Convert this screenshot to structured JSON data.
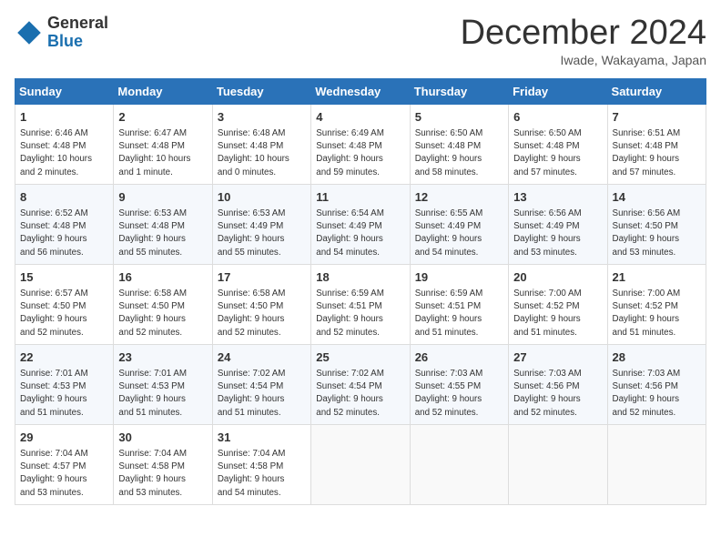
{
  "logo": {
    "general": "General",
    "blue": "Blue"
  },
  "header": {
    "month": "December 2024",
    "location": "Iwade, Wakayama, Japan"
  },
  "days_of_week": [
    "Sunday",
    "Monday",
    "Tuesday",
    "Wednesday",
    "Thursday",
    "Friday",
    "Saturday"
  ],
  "weeks": [
    [
      {
        "day": 1,
        "info": "Sunrise: 6:46 AM\nSunset: 4:48 PM\nDaylight: 10 hours\nand 2 minutes."
      },
      {
        "day": 2,
        "info": "Sunrise: 6:47 AM\nSunset: 4:48 PM\nDaylight: 10 hours\nand 1 minute."
      },
      {
        "day": 3,
        "info": "Sunrise: 6:48 AM\nSunset: 4:48 PM\nDaylight: 10 hours\nand 0 minutes."
      },
      {
        "day": 4,
        "info": "Sunrise: 6:49 AM\nSunset: 4:48 PM\nDaylight: 9 hours\nand 59 minutes."
      },
      {
        "day": 5,
        "info": "Sunrise: 6:50 AM\nSunset: 4:48 PM\nDaylight: 9 hours\nand 58 minutes."
      },
      {
        "day": 6,
        "info": "Sunrise: 6:50 AM\nSunset: 4:48 PM\nDaylight: 9 hours\nand 57 minutes."
      },
      {
        "day": 7,
        "info": "Sunrise: 6:51 AM\nSunset: 4:48 PM\nDaylight: 9 hours\nand 57 minutes."
      }
    ],
    [
      {
        "day": 8,
        "info": "Sunrise: 6:52 AM\nSunset: 4:48 PM\nDaylight: 9 hours\nand 56 minutes."
      },
      {
        "day": 9,
        "info": "Sunrise: 6:53 AM\nSunset: 4:48 PM\nDaylight: 9 hours\nand 55 minutes."
      },
      {
        "day": 10,
        "info": "Sunrise: 6:53 AM\nSunset: 4:49 PM\nDaylight: 9 hours\nand 55 minutes."
      },
      {
        "day": 11,
        "info": "Sunrise: 6:54 AM\nSunset: 4:49 PM\nDaylight: 9 hours\nand 54 minutes."
      },
      {
        "day": 12,
        "info": "Sunrise: 6:55 AM\nSunset: 4:49 PM\nDaylight: 9 hours\nand 54 minutes."
      },
      {
        "day": 13,
        "info": "Sunrise: 6:56 AM\nSunset: 4:49 PM\nDaylight: 9 hours\nand 53 minutes."
      },
      {
        "day": 14,
        "info": "Sunrise: 6:56 AM\nSunset: 4:50 PM\nDaylight: 9 hours\nand 53 minutes."
      }
    ],
    [
      {
        "day": 15,
        "info": "Sunrise: 6:57 AM\nSunset: 4:50 PM\nDaylight: 9 hours\nand 52 minutes."
      },
      {
        "day": 16,
        "info": "Sunrise: 6:58 AM\nSunset: 4:50 PM\nDaylight: 9 hours\nand 52 minutes."
      },
      {
        "day": 17,
        "info": "Sunrise: 6:58 AM\nSunset: 4:50 PM\nDaylight: 9 hours\nand 52 minutes."
      },
      {
        "day": 18,
        "info": "Sunrise: 6:59 AM\nSunset: 4:51 PM\nDaylight: 9 hours\nand 52 minutes."
      },
      {
        "day": 19,
        "info": "Sunrise: 6:59 AM\nSunset: 4:51 PM\nDaylight: 9 hours\nand 51 minutes."
      },
      {
        "day": 20,
        "info": "Sunrise: 7:00 AM\nSunset: 4:52 PM\nDaylight: 9 hours\nand 51 minutes."
      },
      {
        "day": 21,
        "info": "Sunrise: 7:00 AM\nSunset: 4:52 PM\nDaylight: 9 hours\nand 51 minutes."
      }
    ],
    [
      {
        "day": 22,
        "info": "Sunrise: 7:01 AM\nSunset: 4:53 PM\nDaylight: 9 hours\nand 51 minutes."
      },
      {
        "day": 23,
        "info": "Sunrise: 7:01 AM\nSunset: 4:53 PM\nDaylight: 9 hours\nand 51 minutes."
      },
      {
        "day": 24,
        "info": "Sunrise: 7:02 AM\nSunset: 4:54 PM\nDaylight: 9 hours\nand 51 minutes."
      },
      {
        "day": 25,
        "info": "Sunrise: 7:02 AM\nSunset: 4:54 PM\nDaylight: 9 hours\nand 52 minutes."
      },
      {
        "day": 26,
        "info": "Sunrise: 7:03 AM\nSunset: 4:55 PM\nDaylight: 9 hours\nand 52 minutes."
      },
      {
        "day": 27,
        "info": "Sunrise: 7:03 AM\nSunset: 4:56 PM\nDaylight: 9 hours\nand 52 minutes."
      },
      {
        "day": 28,
        "info": "Sunrise: 7:03 AM\nSunset: 4:56 PM\nDaylight: 9 hours\nand 52 minutes."
      }
    ],
    [
      {
        "day": 29,
        "info": "Sunrise: 7:04 AM\nSunset: 4:57 PM\nDaylight: 9 hours\nand 53 minutes."
      },
      {
        "day": 30,
        "info": "Sunrise: 7:04 AM\nSunset: 4:58 PM\nDaylight: 9 hours\nand 53 minutes."
      },
      {
        "day": 31,
        "info": "Sunrise: 7:04 AM\nSunset: 4:58 PM\nDaylight: 9 hours\nand 54 minutes."
      },
      {
        "day": null,
        "info": ""
      },
      {
        "day": null,
        "info": ""
      },
      {
        "day": null,
        "info": ""
      },
      {
        "day": null,
        "info": ""
      }
    ]
  ]
}
